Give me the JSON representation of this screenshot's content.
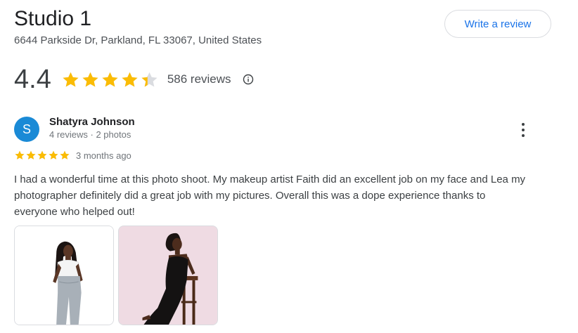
{
  "place": {
    "name": "Studio 1",
    "address": "6644 Parkside Dr, Parkland, FL 33067, United States",
    "write_review_label": "Write a review",
    "rating": "4.4",
    "rating_value": 4.4,
    "reviews_count": "586 reviews"
  },
  "review": {
    "avatar_letter": "S",
    "reviewer_name": "Shatyra Johnson",
    "reviewer_meta": "4 reviews · 2 photos",
    "stars": 5,
    "date": "3 months ago",
    "text": "I had a wonderful time at this photo shoot. My makeup artist Faith did an excellent job on my face and Lea my photographer definitely did a great job with my pictures. Overall this was a dope experience thanks to everyone who helped out!"
  },
  "colors": {
    "star": "#fbbc04",
    "star_empty": "#dadce0",
    "link": "#1a73e8",
    "avatar": "#1a8ad6"
  }
}
